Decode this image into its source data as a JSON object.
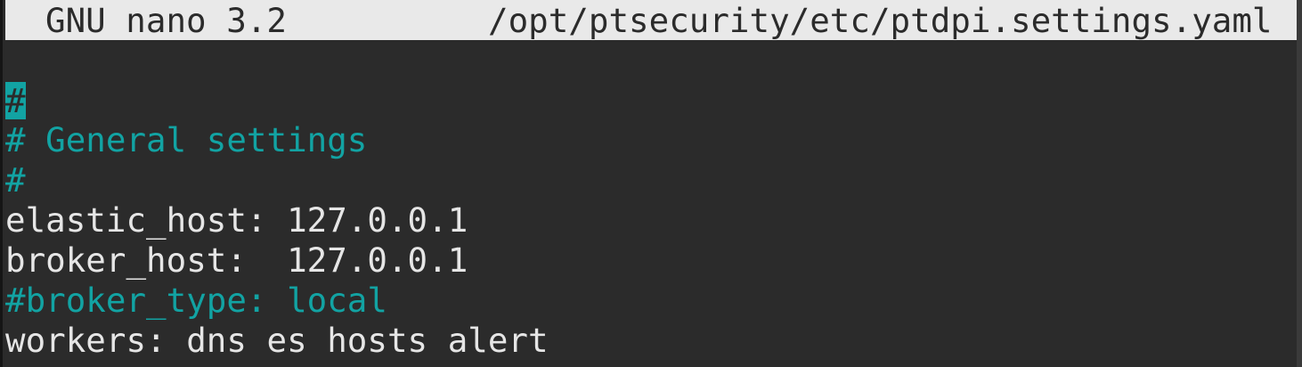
{
  "title_bar": {
    "app_version": "GNU nano 3.2",
    "file_path": "/opt/ptsecurity/etc/ptdpi.settings.yaml"
  },
  "editor": {
    "lines": [
      {
        "text": "#",
        "style": "comment"
      },
      {
        "text": "# General settings",
        "style": "comment"
      },
      {
        "text": "#",
        "style": "comment"
      },
      {
        "text": "elastic_host: 127.0.0.1",
        "style": "normal"
      },
      {
        "text": "broker_host:  127.0.0.1",
        "style": "normal"
      },
      {
        "text": "#broker_type: local",
        "style": "comment"
      },
      {
        "text": "workers: dns es hosts alert",
        "style": "normal"
      }
    ]
  },
  "colors": {
    "background": "#2b2b2b",
    "title_bar": "#e9e9e9",
    "comment": "#12a3a3",
    "text": "#e6e6e6"
  }
}
